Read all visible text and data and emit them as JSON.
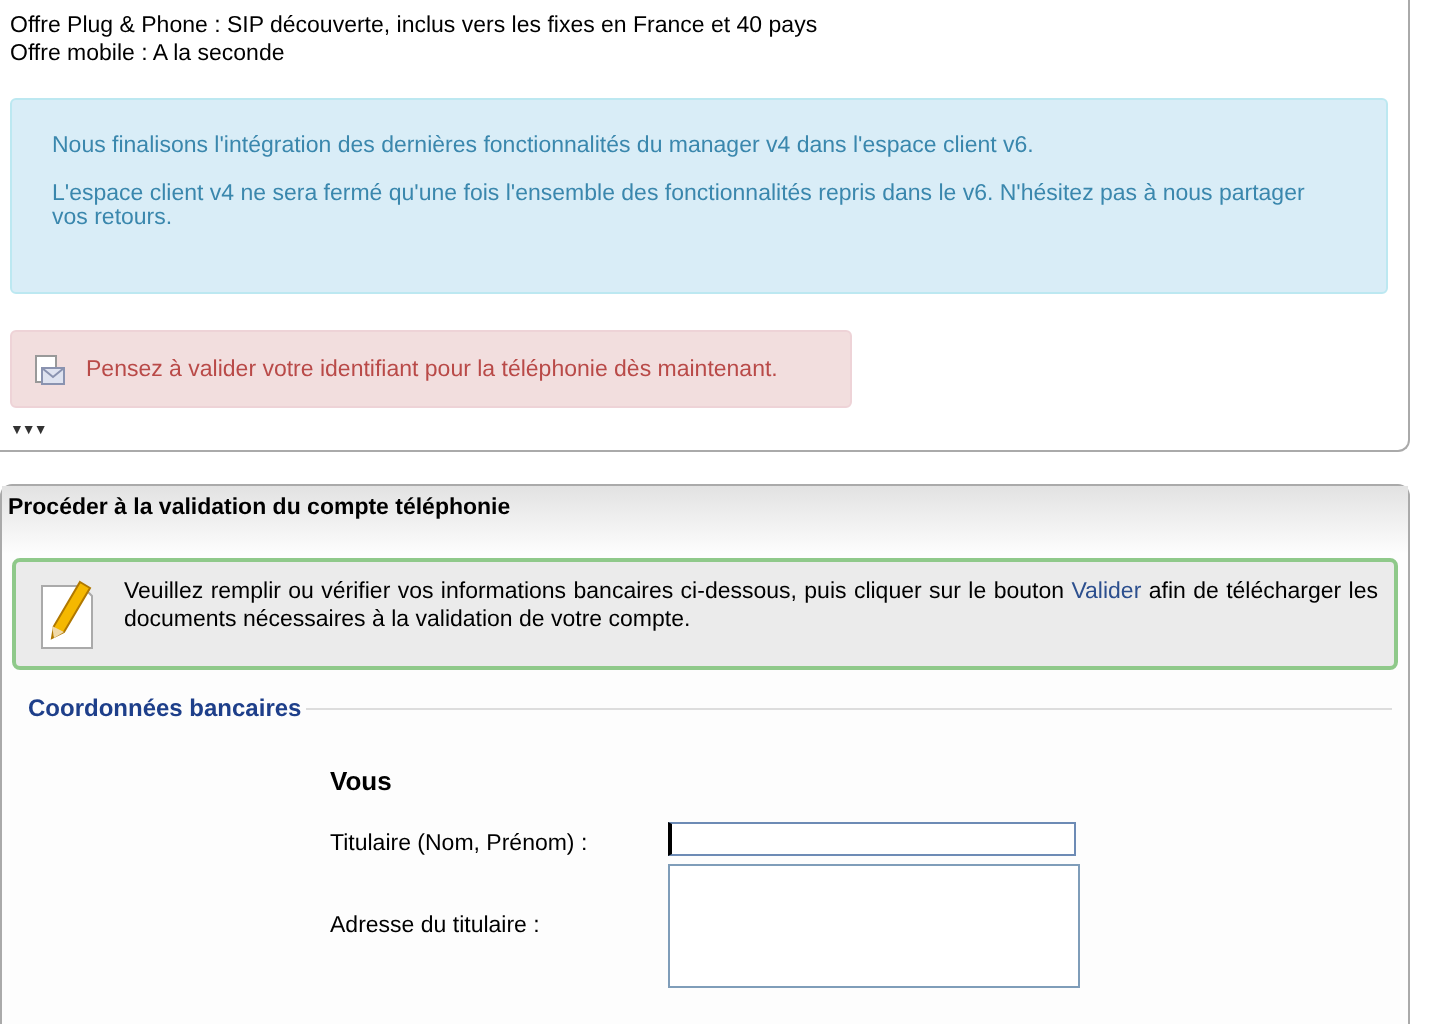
{
  "offers": [
    "Offre Plug & Phone : SIP découverte, inclus vers les fixes en France et 40 pays",
    "Offre mobile : A la seconde"
  ],
  "info_box": {
    "paragraphs": [
      "Nous finalisons l'intégration des dernières fonctionnalités du manager v4 dans l'espace client v6.",
      "L'espace client v4 ne sera fermé qu'une fois l'ensemble des fonctionnalités repris dans le v6. N'hésitez pas à nous partager vos retours."
    ]
  },
  "alert": {
    "text": "Pensez à valider votre identifiant pour la téléphonie dès maintenant."
  },
  "expand_toggle": "▼▼▼",
  "validation_panel": {
    "title": "Procéder à la validation du compte téléphonie",
    "notice": {
      "before": "Veuillez remplir ou vérifier vos informations bancaires ci-dessous, puis cliquer sur le bouton",
      "link": "Valider",
      "after": "afin de télécharger les documents nécessaires à la validation de votre compte."
    },
    "section_title": "Coordonnées bancaires",
    "subheading": "Vous",
    "fields": [
      {
        "kind": "text",
        "label": "Titulaire (Nom, Prénom) :",
        "focused": true
      },
      {
        "kind": "textarea",
        "label": "Adresse du titulaire :",
        "focused": false
      }
    ]
  }
}
